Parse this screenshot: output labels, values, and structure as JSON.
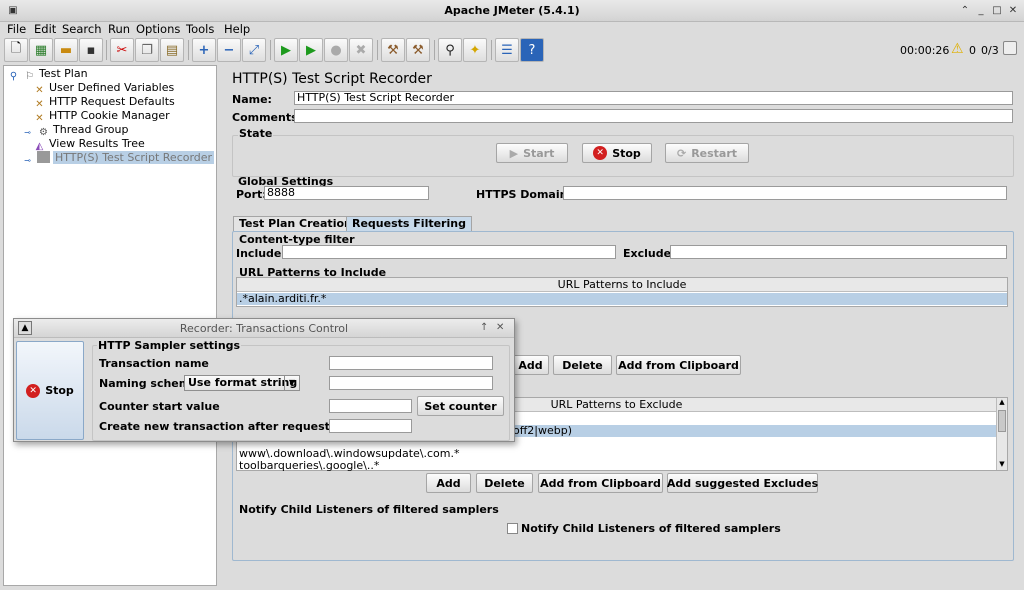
{
  "window": {
    "title": "Apache JMeter (5.4.1)"
  },
  "menu": {
    "items": [
      "File",
      "Edit",
      "Search",
      "Run",
      "Options",
      "Tools",
      "Help"
    ]
  },
  "status": {
    "timer": "00:00:26",
    "warnings": "0",
    "threads": "0/3"
  },
  "tree": {
    "nodes": [
      "Test Plan",
      "User Defined Variables",
      "HTTP Request Defaults",
      "HTTP Cookie Manager",
      "Thread Group",
      "View Results Tree",
      "HTTP(S) Test Script Recorder"
    ]
  },
  "panel": {
    "title": "HTTP(S) Test Script Recorder",
    "name_label": "Name:",
    "name_value": "HTTP(S) Test Script Recorder",
    "comments_label": "Comments:",
    "comments_value": "",
    "state_label": "State",
    "start_label": "Start",
    "stop_label": "Stop",
    "restart_label": "Restart",
    "global_label": "Global Settings",
    "port_label": "Port:",
    "port_value": "8888",
    "https_label": "HTTPS Domains:",
    "https_value": ""
  },
  "tabs": [
    "Test Plan Creation",
    "Requests Filtering"
  ],
  "filter": {
    "content_type_label": "Content-type filter",
    "include_label": "Include:",
    "exclude_label": "Exclude:",
    "url_include_label": "URL Patterns to Include",
    "include_header": "URL Patterns to Include",
    "include_rows": [
      ".*alain.arditi.fr.*"
    ],
    "add_label": "Add",
    "delete_label": "Delete",
    "clipboard_label": "Add from Clipboard",
    "exclude_header": "URL Patterns to Exclude",
    "exclude_row_partial": "off2|webp)",
    "exclude_rows": [
      "www\\.download\\.windowsupdate\\.com.*",
      "toolbarqueries\\.google\\..*"
    ],
    "add2_label": "Add",
    "delete2_label": "Delete",
    "clipboard2_label": "Add from Clipboard",
    "suggested_label": "Add suggested Excludes",
    "notify_group_label": "Notify Child Listeners of filtered samplers",
    "notify_checkbox_label": "Notify Child Listeners of filtered samplers"
  },
  "dialog": {
    "title": "Recorder: Transactions Control",
    "stop_label": "Stop",
    "group_label": "HTTP Sampler settings",
    "transaction_name_label": "Transaction name",
    "naming_scheme_label": "Naming scheme",
    "naming_scheme_value": "Use format string",
    "counter_label": "Counter start value",
    "set_counter_label": "Set counter",
    "new_transaction_label": "Create new transaction after request (ms):"
  }
}
